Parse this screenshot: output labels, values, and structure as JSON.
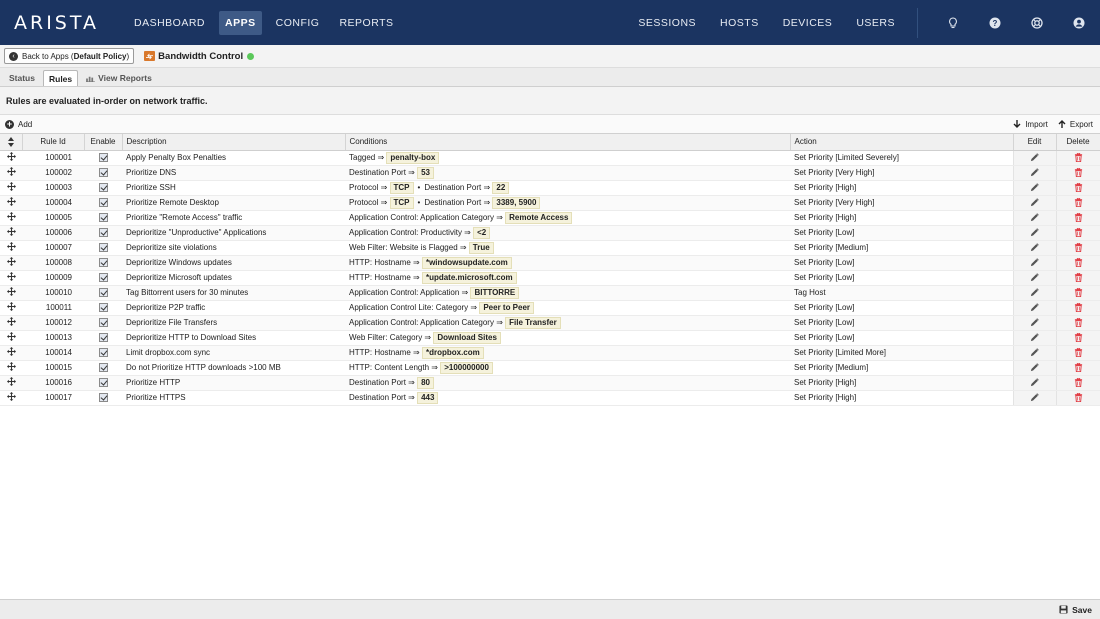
{
  "brand": "ARISTA",
  "nav": {
    "left": [
      "DASHBOARD",
      "APPS",
      "CONFIG",
      "REPORTS"
    ],
    "active": "APPS",
    "right": [
      "SESSIONS",
      "HOSTS",
      "DEVICES",
      "USERS"
    ]
  },
  "subheader": {
    "back_prefix": "Back to Apps (",
    "back_policy": "Default Policy",
    "back_suffix": ")",
    "app_name": "Bandwidth Control",
    "status_color": "#5bc85a"
  },
  "tabs": [
    "Status",
    "Rules",
    "View Reports"
  ],
  "active_tab": "Rules",
  "note": "Rules are evaluated in-order on network traffic.",
  "toolbar": {
    "add": "Add",
    "import": "Import",
    "export": "Export"
  },
  "columns": [
    "Rule Id",
    "Enable",
    "Description",
    "Conditions",
    "Action",
    "Edit",
    "Delete"
  ],
  "rules": [
    {
      "id": "100001",
      "desc": "Apply Penalty Box Penalties",
      "cond": [
        {
          "label": "Tagged ⇒ ",
          "value": "penalty-box"
        }
      ],
      "action": "Set Priority [Limited Severely]"
    },
    {
      "id": "100002",
      "desc": "Prioritize DNS",
      "cond": [
        {
          "label": "Destination Port ⇒ ",
          "value": "53"
        }
      ],
      "action": "Set Priority [Very High]"
    },
    {
      "id": "100003",
      "desc": "Prioritize SSH",
      "cond": [
        {
          "label": "Protocol ⇒ ",
          "value": "TCP"
        },
        {
          "label": "Destination Port ⇒ ",
          "value": "22"
        }
      ],
      "action": "Set Priority [High]"
    },
    {
      "id": "100004",
      "desc": "Prioritize Remote Desktop",
      "cond": [
        {
          "label": "Protocol ⇒ ",
          "value": "TCP"
        },
        {
          "label": "Destination Port ⇒ ",
          "value": "3389, 5900"
        }
      ],
      "action": "Set Priority [Very High]"
    },
    {
      "id": "100005",
      "desc": "Prioritize \"Remote Access\" traffic",
      "cond": [
        {
          "label": "Application Control: Application Category ⇒ ",
          "value": "Remote Access"
        }
      ],
      "action": "Set Priority [High]"
    },
    {
      "id": "100006",
      "desc": "Deprioritize \"Unproductive\" Applications",
      "cond": [
        {
          "label": "Application Control: Productivity ⇒ ",
          "value": "<2"
        }
      ],
      "action": "Set Priority [Low]"
    },
    {
      "id": "100007",
      "desc": "Deprioritize site violations",
      "cond": [
        {
          "label": "Web Filter: Website is Flagged ⇒ ",
          "value": "True"
        }
      ],
      "action": "Set Priority [Medium]"
    },
    {
      "id": "100008",
      "desc": "Deprioritize Windows updates",
      "cond": [
        {
          "label": "HTTP: Hostname ⇒ ",
          "value": "*windowsupdate.com"
        }
      ],
      "action": "Set Priority [Low]"
    },
    {
      "id": "100009",
      "desc": "Deprioritize Microsoft updates",
      "cond": [
        {
          "label": "HTTP: Hostname ⇒ ",
          "value": "*update.microsoft.com"
        }
      ],
      "action": "Set Priority [Low]"
    },
    {
      "id": "100010",
      "desc": "Tag Bittorrent users for 30 minutes",
      "cond": [
        {
          "label": "Application Control: Application ⇒ ",
          "value": "BITTORRE"
        }
      ],
      "action": "Tag Host"
    },
    {
      "id": "100011",
      "desc": "Deprioritize P2P traffic",
      "cond": [
        {
          "label": "Application Control Lite: Category ⇒ ",
          "value": "Peer to Peer"
        }
      ],
      "action": "Set Priority [Low]"
    },
    {
      "id": "100012",
      "desc": "Deprioritize File Transfers",
      "cond": [
        {
          "label": "Application Control: Application Category ⇒ ",
          "value": "File Transfer"
        }
      ],
      "action": "Set Priority [Low]"
    },
    {
      "id": "100013",
      "desc": "Deprioritize HTTP to Download Sites",
      "cond": [
        {
          "label": "Web Filter: Category ⇒ ",
          "value": "Download Sites"
        }
      ],
      "action": "Set Priority [Low]"
    },
    {
      "id": "100014",
      "desc": "Limit dropbox.com sync",
      "cond": [
        {
          "label": "HTTP: Hostname ⇒ ",
          "value": "*dropbox.com"
        }
      ],
      "action": "Set Priority [Limited More]"
    },
    {
      "id": "100015",
      "desc": "Do not Prioritize HTTP downloads >100 MB",
      "cond": [
        {
          "label": "HTTP: Content Length ⇒ ",
          "value": ">100000000"
        }
      ],
      "action": "Set Priority [Medium]"
    },
    {
      "id": "100016",
      "desc": "Prioritize HTTP",
      "cond": [
        {
          "label": "Destination Port ⇒ ",
          "value": "80"
        }
      ],
      "action": "Set Priority [High]"
    },
    {
      "id": "100017",
      "desc": "Prioritize HTTPS",
      "cond": [
        {
          "label": "Destination Port ⇒ ",
          "value": "443"
        }
      ],
      "action": "Set Priority [High]"
    }
  ],
  "save": "Save",
  "colors": {
    "topbar": "#1b3461",
    "active_nav": "#3e5a86",
    "delete": "#e0313a",
    "tag_bg": "#f5f2dc"
  }
}
